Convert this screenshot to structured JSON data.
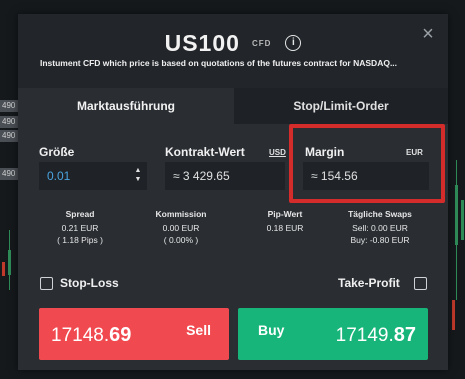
{
  "background": {
    "axis_ticks": [
      "490",
      "490",
      "490",
      "490"
    ]
  },
  "header": {
    "symbol": "US100",
    "badge": "CFD",
    "info_icon": "i",
    "close_icon": "×",
    "subtitle": "Instument CFD which price is based on quotations of the futures contract for NASDAQ..."
  },
  "tabs": [
    {
      "label": "Marktausführung",
      "active": true
    },
    {
      "label": "Stop/Limit-Order",
      "active": false
    }
  ],
  "fields": {
    "size": {
      "label": "Größe",
      "value": "0.01"
    },
    "contract": {
      "label": "Kontrakt-Wert",
      "unit": "USD",
      "value": "≈ 3 429.65"
    },
    "margin": {
      "label": "Margin",
      "unit": "EUR",
      "value": "≈ 154.56"
    }
  },
  "stats": {
    "spread": {
      "title": "Spread",
      "line1": "0.21 EUR",
      "line2": "( 1.18 Pips )"
    },
    "commission": {
      "title": "Kommission",
      "line1": "0.00 EUR",
      "line2": "( 0.00% )"
    },
    "pip_value": {
      "title": "Pip-Wert",
      "line1": "0.18 EUR"
    },
    "swaps": {
      "title": "Tägliche Swaps",
      "line1": "Sell: 0.00 EUR",
      "line2": "Buy: -0.80 EUR"
    }
  },
  "options": {
    "stop_loss": "Stop-Loss",
    "take_profit": "Take-Profit"
  },
  "actions": {
    "sell": {
      "label": "Sell",
      "price_main": "17148.",
      "price_big": "69"
    },
    "buy": {
      "label": "Buy",
      "price_main": "17149.",
      "price_big": "87"
    }
  },
  "colors": {
    "sell": "#f04a50",
    "buy": "#17b57a",
    "highlight": "#d42b2b",
    "size_value": "#4aa3df"
  }
}
